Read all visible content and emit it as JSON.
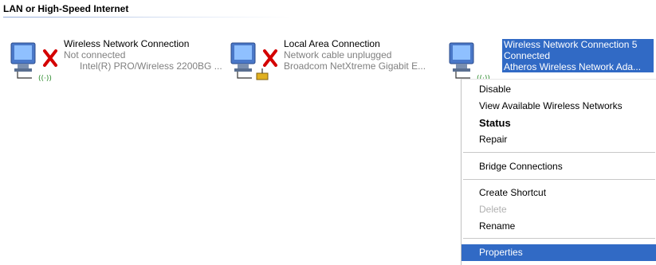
{
  "section": {
    "title": "LAN or High-Speed Internet"
  },
  "connections": [
    {
      "name": "Wireless Network Connection",
      "status": "Not connected",
      "device": "Intel(R) PRO/Wireless 2200BG ...",
      "icon": "computer-icon",
      "status_icon": "red-x-icon",
      "adapter_icon": "wireless-signal-icon"
    },
    {
      "name": "Local Area Connection",
      "status": "Network cable unplugged",
      "device": "Broadcom NetXtreme Gigabit E...",
      "icon": "computer-icon",
      "status_icon": "red-x-icon",
      "adapter_icon": "network-cable-icon"
    },
    {
      "name": "Wireless Network Connection 5",
      "status": "Connected",
      "device": "Atheros Wireless Network Ada...",
      "icon": "computer-icon",
      "adapter_icon": "wireless-signal-icon"
    }
  ],
  "context_menu": {
    "items": [
      {
        "label": "Disable"
      },
      {
        "label": "View Available Wireless Networks"
      },
      {
        "label": "Status",
        "bold": true
      },
      {
        "label": "Repair"
      },
      {
        "label": "Bridge Connections"
      },
      {
        "label": "Create Shortcut"
      },
      {
        "label": "Delete",
        "disabled": true
      },
      {
        "label": "Rename"
      },
      {
        "label": "Properties",
        "highlighted": true
      }
    ]
  },
  "colors": {
    "selection": "#316ac5",
    "status_gray": "#808080",
    "error_red": "#d40000"
  }
}
